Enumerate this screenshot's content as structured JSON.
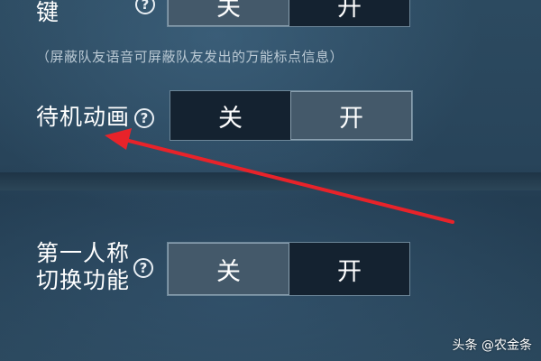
{
  "settings": {
    "row_top": {
      "label_partial": "键",
      "help_icon_glyph": "?",
      "off_label": "关",
      "on_label": "开",
      "selected": "off",
      "note": "（屏蔽队友语音可屏蔽队友发出的万能标点信息）"
    },
    "idle_animation": {
      "label": "待机动画",
      "help_icon_glyph": "?",
      "off_label": "关",
      "on_label": "开",
      "selected": "on"
    },
    "first_person_switch": {
      "label_line1": "第一人称",
      "label_line2": "切换功能",
      "help_icon_glyph": "?",
      "off_label": "关",
      "on_label": "开",
      "selected": "off"
    }
  },
  "annotation": {
    "arrow_color": "#e8232a"
  },
  "watermark": {
    "text": "头条 @农金条"
  },
  "colors": {
    "active_segment": "#44596a",
    "inactive_segment": "#142230",
    "background": "#28445a"
  }
}
